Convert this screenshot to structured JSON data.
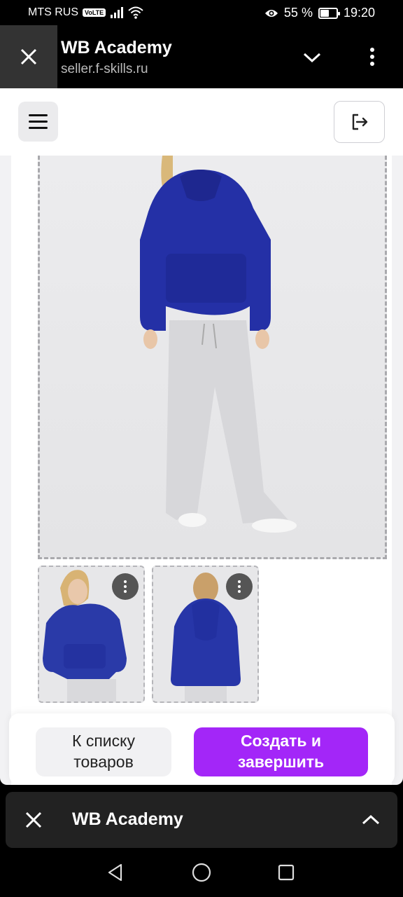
{
  "status": {
    "carrier": "MTS RUS",
    "volte": "VoLTE",
    "battery_text": "55 %",
    "battery_level": 0.55,
    "time": "19:20"
  },
  "browser": {
    "title": "WB Academy",
    "url": "seller.f-skills.ru",
    "icons": [
      "close-icon",
      "chevron-down-icon",
      "more-vertical-icon"
    ]
  },
  "app": {
    "icons": [
      "menu-icon",
      "logout-icon"
    ]
  },
  "actions": {
    "back_label": "К списку товаров",
    "create_label": "Создать и завершить",
    "accent_color": "#a326f8"
  },
  "bubble": {
    "title": "WB Academy",
    "icons": [
      "close-icon",
      "chevron-up-icon"
    ]
  },
  "navigation": [
    "back-icon",
    "home-icon",
    "recents-icon"
  ]
}
